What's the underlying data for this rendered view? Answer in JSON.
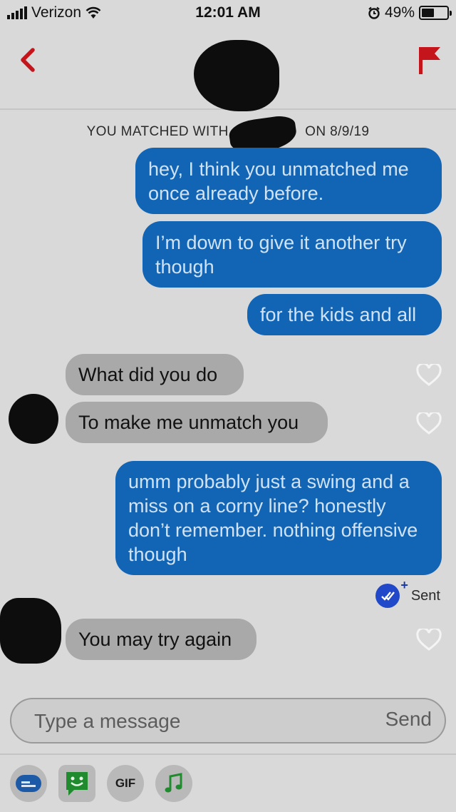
{
  "status_bar": {
    "carrier": "Verizon",
    "time": "12:01 AM",
    "battery": "49%",
    "battery_level": 0.49
  },
  "header": {
    "back_icon": "chevron-left-icon",
    "report_icon": "flag-icon"
  },
  "match_banner": {
    "prefix": "YOU MATCHED WITH",
    "suffix": "ON 8/9/19"
  },
  "messages": [
    {
      "direction": "outgoing",
      "text": "hey, I think you unmatched me once already before."
    },
    {
      "direction": "outgoing",
      "text": "I’m down to give it another try though"
    },
    {
      "direction": "outgoing",
      "text": "for the kids and all"
    },
    {
      "direction": "incoming",
      "text": "What did you do"
    },
    {
      "direction": "incoming",
      "text": "To make me unmatch you"
    },
    {
      "direction": "outgoing",
      "text": "umm probably just a swing and a miss on a corny line? honestly don’t remember. nothing offensive though"
    },
    {
      "direction": "incoming",
      "text": "You may try again"
    }
  ],
  "read_receipt": {
    "label": "Sent",
    "plus": "+"
  },
  "composer": {
    "placeholder": "Type a message",
    "send_label": "Send"
  },
  "toolbar": {
    "gif_label": "GIF",
    "icons": [
      "sticker-icon",
      "emoji-icon",
      "gif-icon",
      "music-icon"
    ]
  },
  "colors": {
    "outgoing_bubble": "#1264b4",
    "incoming_bubble": "#a9a9a9",
    "accent_red": "#c4141c",
    "background": "#d9d9d9"
  }
}
